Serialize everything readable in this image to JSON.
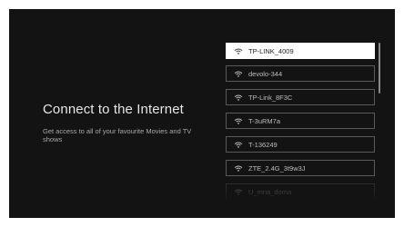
{
  "page": {
    "title": "Connect to the Internet",
    "subtitle": "Get access to all of your favourite Movies and TV shows"
  },
  "networks": [
    {
      "name": "TP-LINK_4009",
      "icon": "wifi-icon",
      "selected": true
    },
    {
      "name": "devolo-344",
      "icon": "wifi-icon",
      "selected": false
    },
    {
      "name": "TP-Link_8F3C",
      "icon": "wifi-icon",
      "selected": false
    },
    {
      "name": "T-3uRM7a",
      "icon": "wifi-icon",
      "selected": false
    },
    {
      "name": "T-136249",
      "icon": "wifi-icon",
      "selected": false
    },
    {
      "name": "ZTE_2.4G_3t9w3J",
      "icon": "wifi-icon",
      "selected": false
    },
    {
      "name": "U_mna_doma",
      "icon": "wifi-icon",
      "selected": false
    }
  ],
  "colors": {
    "background": "#131313",
    "selected_item": "#ffffff",
    "item_border": "#5a5a5a"
  }
}
